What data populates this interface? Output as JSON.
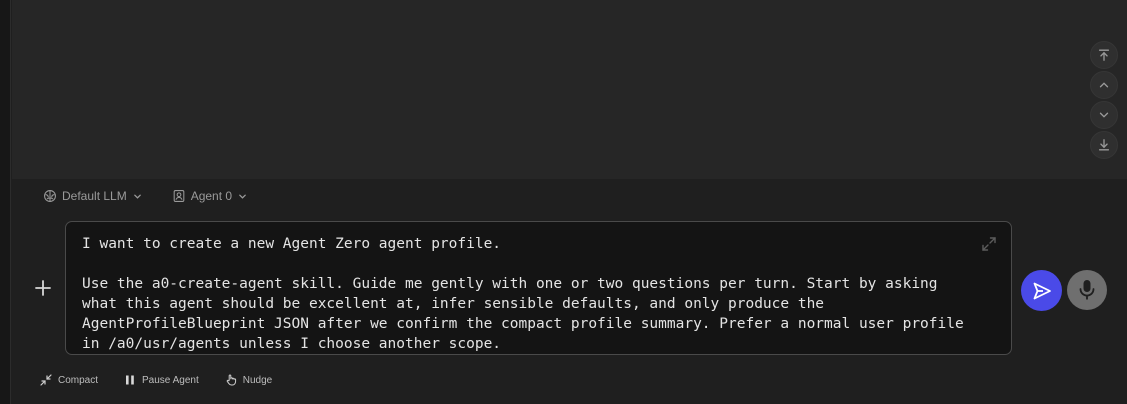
{
  "composer": {
    "model_selector": {
      "label": "Default LLM",
      "icon": "brain-icon"
    },
    "agent_selector": {
      "label": "Agent 0",
      "icon": "agent-badge-icon"
    },
    "input": {
      "value": "I want to create a new Agent Zero agent profile.\n\nUse the a0-create-agent skill. Guide me gently with one or two questions per turn. Start by asking what this agent should be excellent at, infer sensible defaults, and only produce the AgentProfileBlueprint JSON after we confirm the compact profile summary. Prefer a normal user profile in /a0/usr/agents unless I choose another scope."
    },
    "actions": [
      {
        "label": "Compact",
        "icon": "compress-icon"
      },
      {
        "label": "Pause Agent",
        "icon": "pause-icon"
      },
      {
        "label": "Nudge",
        "icon": "hand-pointer-icon"
      }
    ]
  },
  "colors": {
    "send_button": "#4a4ae8",
    "mic_button": "#6f6f6f",
    "panel_bg": "#262626",
    "composer_bg": "#1f1f1f",
    "input_bg": "#141414"
  }
}
